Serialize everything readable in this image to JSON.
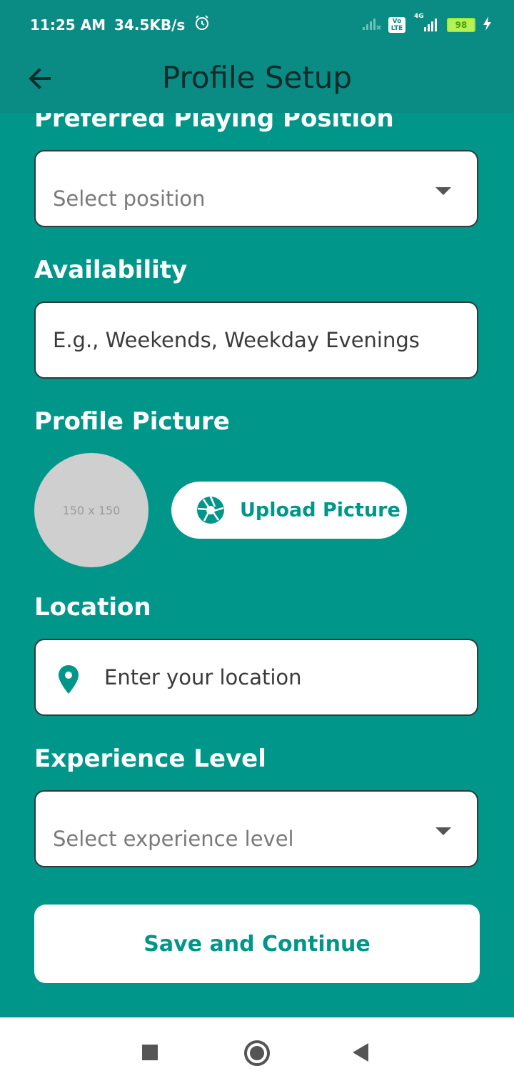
{
  "status_bar": {
    "time": "11:25 AM",
    "net_speed": "34.5KB/s",
    "battery": "98",
    "volte_label": "Vo LTE",
    "network_label": "4G"
  },
  "app_bar": {
    "title": "Profile Setup"
  },
  "form": {
    "position_section_label": "Preferred Playing Position",
    "position_placeholder": "Select position",
    "availability_label": "Availability",
    "availability_placeholder": "E.g., Weekends, Weekday Evenings",
    "picture_label": "Profile Picture",
    "avatar_placeholder": "150 x 150",
    "upload_button": "Upload Picture",
    "location_label": "Location",
    "location_placeholder": "Enter your location",
    "experience_label": "Experience Level",
    "experience_placeholder": "Select experience level",
    "save_button": "Save and Continue"
  },
  "colors": {
    "background": "#00978a",
    "app_bar": "#0a8b84",
    "accent": "#00978a"
  },
  "icons": {
    "back": "arrow-left-icon",
    "upload": "camera-aperture-icon",
    "location": "location-pin-icon",
    "dropdown": "dropdown-triangle-icon"
  }
}
